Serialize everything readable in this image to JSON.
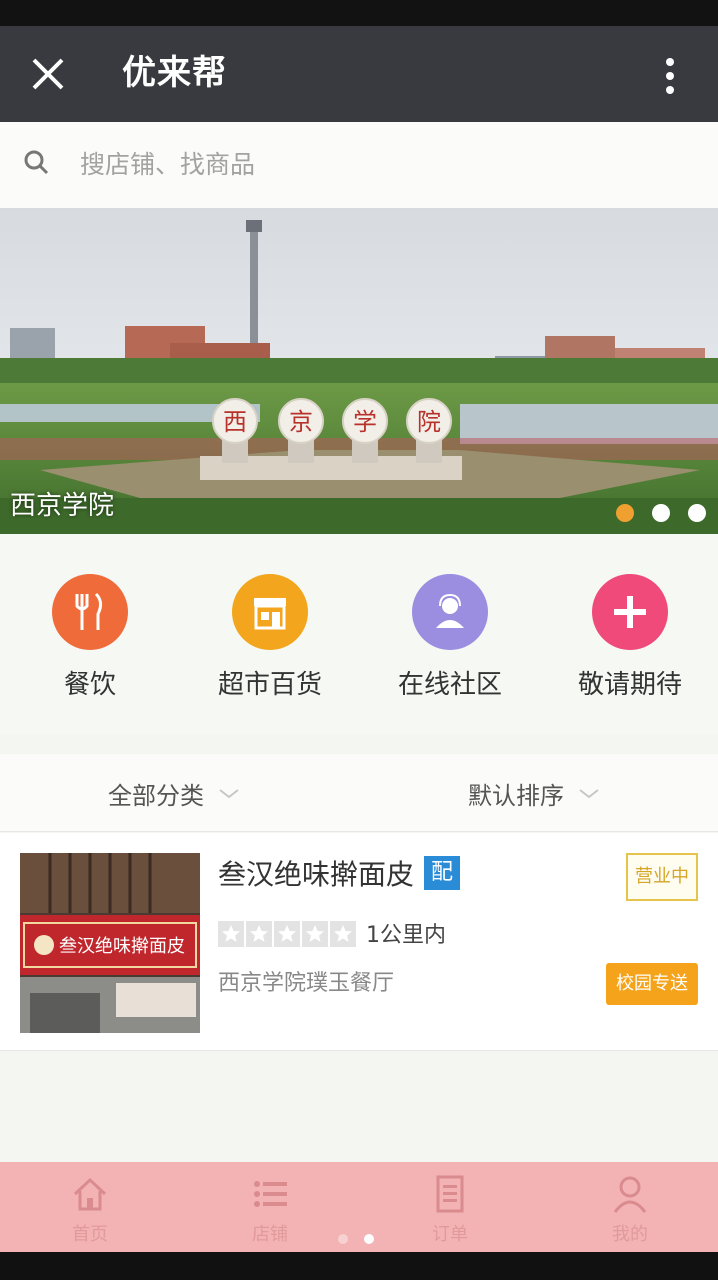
{
  "app": {
    "title": "优来帮"
  },
  "search": {
    "placeholder": "搜店铺、找商品"
  },
  "banner": {
    "caption": "西京学院",
    "sign_chars": [
      "西",
      "京",
      "学",
      "院"
    ],
    "slides": 3,
    "active_slide": 1
  },
  "categories": [
    {
      "label": "餐饮",
      "icon": "fork-knife-icon",
      "color": "#ef6b3a"
    },
    {
      "label": "超市百货",
      "icon": "store-icon",
      "color": "#f2a51d"
    },
    {
      "label": "在线社区",
      "icon": "support-agent-icon",
      "color": "#9b8de0"
    },
    {
      "label": "敬请期待",
      "icon": "plus-icon",
      "color": "#ef4a7a"
    }
  ],
  "filters": {
    "category": "全部分类",
    "sort": "默认排序"
  },
  "shops": [
    {
      "name": "叁汉绝味擀面皮",
      "delivery_badge": "配",
      "status": "营业中",
      "rating": 0,
      "distance": "1公里内",
      "address": "西京学院璞玉餐厅",
      "tag": "校园专送",
      "storefront_sign": "叁汉绝味擀面皮"
    }
  ],
  "tabs": [
    {
      "label": "首页",
      "icon": "home-icon"
    },
    {
      "label": "店铺",
      "icon": "list-icon"
    },
    {
      "label": "订单",
      "icon": "order-icon"
    },
    {
      "label": "我的",
      "icon": "user-icon"
    }
  ],
  "colors": {
    "titlebar": "#393a3f",
    "accent_orange": "#f4a31b",
    "tabbar": "#f3b3b4",
    "pei_badge": "#2a8bd6"
  }
}
